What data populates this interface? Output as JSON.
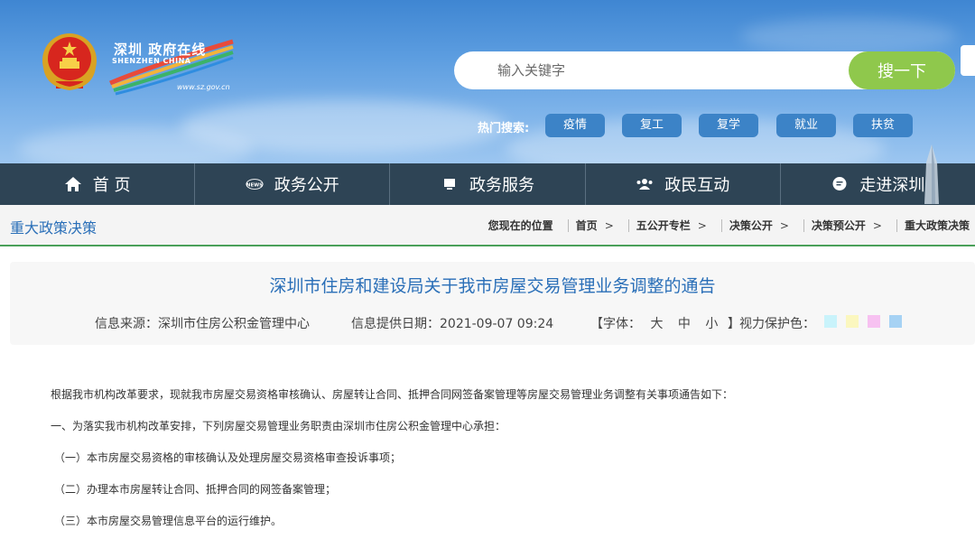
{
  "header": {
    "logo_cn": "深圳 政府在线",
    "logo_en": "SHENZHEN CHINA",
    "logo_url": "www.sz.gov.cn",
    "search": {
      "placeholder": "输入关键字",
      "button": "搜一下"
    },
    "hot_search_label": "热门搜索:",
    "hot_tags": [
      "疫情",
      "复工",
      "复学",
      "就业",
      "扶贫"
    ]
  },
  "nav": {
    "items": [
      {
        "label": "首 页",
        "icon": "home-icon"
      },
      {
        "label": "政务公开",
        "icon": "news-icon"
      },
      {
        "label": "政务服务",
        "icon": "monitor-icon"
      },
      {
        "label": "政民互动",
        "icon": "people-icon"
      },
      {
        "label": "走进深圳",
        "icon": "chat-icon"
      }
    ]
  },
  "breadcrumb_bar": {
    "section_title": "重大政策决策",
    "here_label": "您现在的位置",
    "crumbs": [
      "首页",
      "五公开专栏",
      "决策公开",
      "决策预公开",
      "重大政策决策"
    ],
    "separator": ">"
  },
  "article": {
    "title": "深圳市住房和建设局关于我市房屋交易管理业务调整的通告",
    "source": "信息来源：深圳市住房公积金管理中心",
    "date": "信息提供日期：2021-09-07 09:24",
    "font_label_open": "【字体：",
    "font_sizes": [
      "大",
      "中",
      "小"
    ],
    "font_label_close": "】",
    "eye_care_label": "视力保护色：",
    "eye_care_colors": [
      "#c9f3fb",
      "#fbf7bf",
      "#f7c1f1",
      "#a6d2f4"
    ],
    "paragraphs": [
      "根据我市机构改革要求，现就我市房屋交易资格审核确认、房屋转让合同、抵押合同网签备案管理等房屋交易管理业务调整有关事项通告如下：",
      "一、为落实我市机构改革安排，下列房屋交易管理业务职责由深圳市住房公积金管理中心承担：",
      "（一）本市房屋交易资格的审核确认及处理房屋交易资格审查投诉事项；",
      "（二）办理本市房屋转让合同、抵押合同的网签备案管理；",
      "（三）本市房屋交易管理信息平台的运行维护。"
    ]
  },
  "colors": {
    "nav_bg": "#2e4455",
    "link_blue": "#2a6fb8",
    "search_green": "#8fc84c",
    "tag_blue": "#3c83c7",
    "accent_green_line": "#4aa05a"
  }
}
